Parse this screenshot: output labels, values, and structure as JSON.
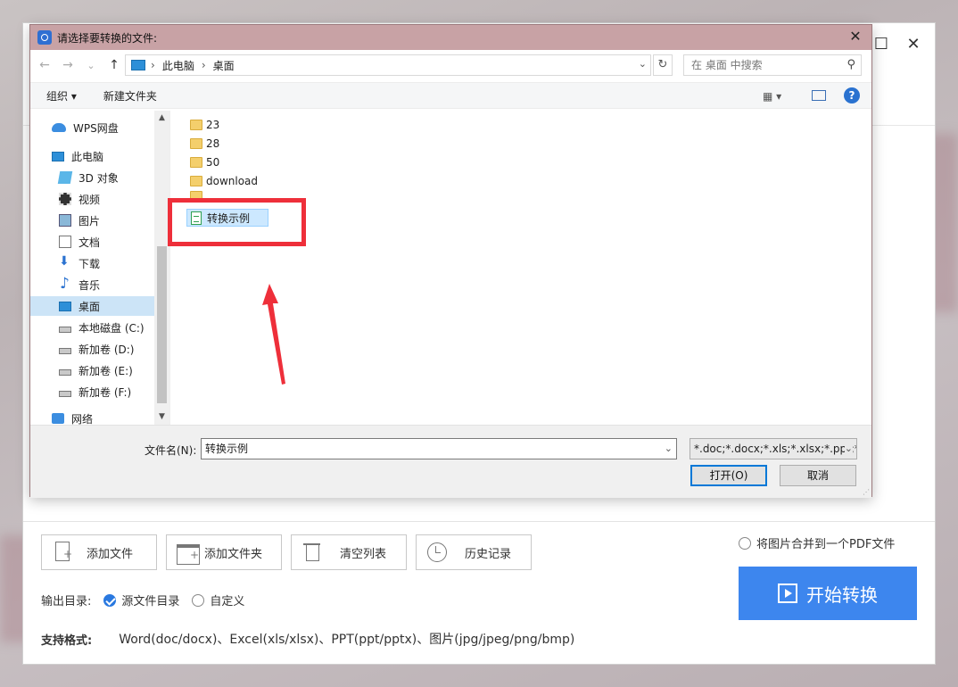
{
  "app": {
    "window_controls": {
      "maximize": "☐",
      "close": "✕"
    },
    "toolbar": [
      {
        "label": "添加文件",
        "icon": "add-file-icon"
      },
      {
        "label": "添加文件夹",
        "icon": "add-folder-icon"
      },
      {
        "label": "清空列表",
        "icon": "trash-icon"
      },
      {
        "label": "历史记录",
        "icon": "clock-icon"
      }
    ],
    "merge_option": "将图片合并到一个PDF文件",
    "start_button": "开始转换",
    "output": {
      "label": "输出目录:",
      "option_source": "源文件目录",
      "option_custom": "自定义",
      "selected": "源文件目录"
    },
    "formats": {
      "label": "支持格式:",
      "value": "Word(doc/docx)、Excel(xls/xlsx)、PPT(ppt/pptx)、图片(jpg/jpeg/png/bmp)"
    }
  },
  "dialog": {
    "title": "请选择要转换的文件:",
    "close": "✕",
    "nav": {
      "back": "←",
      "forward": "→",
      "recent": "⌄",
      "up": "↑"
    },
    "address": [
      "此电脑",
      "桌面"
    ],
    "refresh": "↻",
    "search_placeholder": "在 桌面 中搜索",
    "search_icon": "⚲",
    "commands": {
      "organize": "组织 ▾",
      "new_folder": "新建文件夹",
      "view": "▦ ▾",
      "help": "?"
    },
    "nav_items": [
      {
        "label": "WPS网盘",
        "icon": "cloud-icon"
      },
      {
        "label": "此电脑",
        "icon": "computer-icon"
      },
      {
        "label": "3D 对象",
        "icon": "3d-objects-icon"
      },
      {
        "label": "视频",
        "icon": "video-icon"
      },
      {
        "label": "图片",
        "icon": "picture-icon"
      },
      {
        "label": "文档",
        "icon": "document-icon"
      },
      {
        "label": "下载",
        "icon": "download-icon"
      },
      {
        "label": "音乐",
        "icon": "music-icon"
      },
      {
        "label": "桌面",
        "icon": "desktop-icon",
        "selected": true
      },
      {
        "label": "本地磁盘 (C:)",
        "icon": "disk-icon"
      },
      {
        "label": "新加卷 (D:)",
        "icon": "disk-icon"
      },
      {
        "label": "新加卷 (E:)",
        "icon": "disk-icon"
      },
      {
        "label": "新加卷 (F:)",
        "icon": "disk-icon"
      },
      {
        "label": "网络",
        "icon": "network-icon"
      }
    ],
    "files": [
      {
        "name": "23",
        "type": "folder"
      },
      {
        "name": "28",
        "type": "folder"
      },
      {
        "name": "50",
        "type": "folder"
      },
      {
        "name": "download",
        "type": "folder"
      },
      {
        "name": "转换示例",
        "type": "document",
        "selected": true
      }
    ],
    "filename_label": "文件名(N):",
    "filename_value": "转换示例",
    "filetype_value": "*.doc;*.docx;*.xls;*.xlsx;*.ppt;*.pptx",
    "open_button": "打开(O)",
    "cancel_button": "取消",
    "dropdown_glyph": "⌄"
  },
  "colors": {
    "accent": "#3d86ee",
    "title_bar": "#c8a2a5",
    "selection": "#cce8ff",
    "highlight_box": "#ee2f3a"
  }
}
